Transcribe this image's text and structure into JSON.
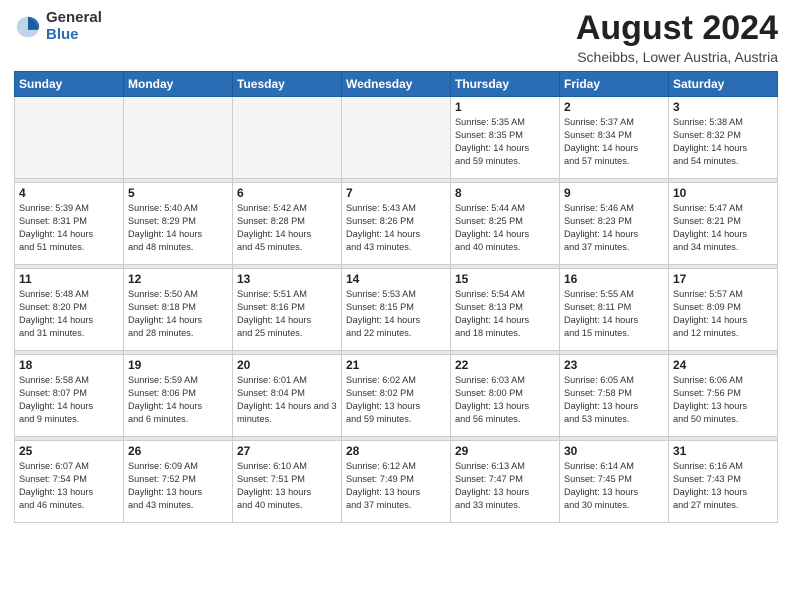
{
  "logo": {
    "general": "General",
    "blue": "Blue"
  },
  "title": "August 2024",
  "location": "Scheibbs, Lower Austria, Austria",
  "days_of_week": [
    "Sunday",
    "Monday",
    "Tuesday",
    "Wednesday",
    "Thursday",
    "Friday",
    "Saturday"
  ],
  "weeks": [
    [
      {
        "day": "",
        "info": ""
      },
      {
        "day": "",
        "info": ""
      },
      {
        "day": "",
        "info": ""
      },
      {
        "day": "",
        "info": ""
      },
      {
        "day": "1",
        "info": "Sunrise: 5:35 AM\nSunset: 8:35 PM\nDaylight: 14 hours\nand 59 minutes."
      },
      {
        "day": "2",
        "info": "Sunrise: 5:37 AM\nSunset: 8:34 PM\nDaylight: 14 hours\nand 57 minutes."
      },
      {
        "day": "3",
        "info": "Sunrise: 5:38 AM\nSunset: 8:32 PM\nDaylight: 14 hours\nand 54 minutes."
      }
    ],
    [
      {
        "day": "4",
        "info": "Sunrise: 5:39 AM\nSunset: 8:31 PM\nDaylight: 14 hours\nand 51 minutes."
      },
      {
        "day": "5",
        "info": "Sunrise: 5:40 AM\nSunset: 8:29 PM\nDaylight: 14 hours\nand 48 minutes."
      },
      {
        "day": "6",
        "info": "Sunrise: 5:42 AM\nSunset: 8:28 PM\nDaylight: 14 hours\nand 45 minutes."
      },
      {
        "day": "7",
        "info": "Sunrise: 5:43 AM\nSunset: 8:26 PM\nDaylight: 14 hours\nand 43 minutes."
      },
      {
        "day": "8",
        "info": "Sunrise: 5:44 AM\nSunset: 8:25 PM\nDaylight: 14 hours\nand 40 minutes."
      },
      {
        "day": "9",
        "info": "Sunrise: 5:46 AM\nSunset: 8:23 PM\nDaylight: 14 hours\nand 37 minutes."
      },
      {
        "day": "10",
        "info": "Sunrise: 5:47 AM\nSunset: 8:21 PM\nDaylight: 14 hours\nand 34 minutes."
      }
    ],
    [
      {
        "day": "11",
        "info": "Sunrise: 5:48 AM\nSunset: 8:20 PM\nDaylight: 14 hours\nand 31 minutes."
      },
      {
        "day": "12",
        "info": "Sunrise: 5:50 AM\nSunset: 8:18 PM\nDaylight: 14 hours\nand 28 minutes."
      },
      {
        "day": "13",
        "info": "Sunrise: 5:51 AM\nSunset: 8:16 PM\nDaylight: 14 hours\nand 25 minutes."
      },
      {
        "day": "14",
        "info": "Sunrise: 5:53 AM\nSunset: 8:15 PM\nDaylight: 14 hours\nand 22 minutes."
      },
      {
        "day": "15",
        "info": "Sunrise: 5:54 AM\nSunset: 8:13 PM\nDaylight: 14 hours\nand 18 minutes."
      },
      {
        "day": "16",
        "info": "Sunrise: 5:55 AM\nSunset: 8:11 PM\nDaylight: 14 hours\nand 15 minutes."
      },
      {
        "day": "17",
        "info": "Sunrise: 5:57 AM\nSunset: 8:09 PM\nDaylight: 14 hours\nand 12 minutes."
      }
    ],
    [
      {
        "day": "18",
        "info": "Sunrise: 5:58 AM\nSunset: 8:07 PM\nDaylight: 14 hours\nand 9 minutes."
      },
      {
        "day": "19",
        "info": "Sunrise: 5:59 AM\nSunset: 8:06 PM\nDaylight: 14 hours\nand 6 minutes."
      },
      {
        "day": "20",
        "info": "Sunrise: 6:01 AM\nSunset: 8:04 PM\nDaylight: 14 hours and 3 minutes."
      },
      {
        "day": "21",
        "info": "Sunrise: 6:02 AM\nSunset: 8:02 PM\nDaylight: 13 hours\nand 59 minutes."
      },
      {
        "day": "22",
        "info": "Sunrise: 6:03 AM\nSunset: 8:00 PM\nDaylight: 13 hours\nand 56 minutes."
      },
      {
        "day": "23",
        "info": "Sunrise: 6:05 AM\nSunset: 7:58 PM\nDaylight: 13 hours\nand 53 minutes."
      },
      {
        "day": "24",
        "info": "Sunrise: 6:06 AM\nSunset: 7:56 PM\nDaylight: 13 hours\nand 50 minutes."
      }
    ],
    [
      {
        "day": "25",
        "info": "Sunrise: 6:07 AM\nSunset: 7:54 PM\nDaylight: 13 hours\nand 46 minutes."
      },
      {
        "day": "26",
        "info": "Sunrise: 6:09 AM\nSunset: 7:52 PM\nDaylight: 13 hours\nand 43 minutes."
      },
      {
        "day": "27",
        "info": "Sunrise: 6:10 AM\nSunset: 7:51 PM\nDaylight: 13 hours\nand 40 minutes."
      },
      {
        "day": "28",
        "info": "Sunrise: 6:12 AM\nSunset: 7:49 PM\nDaylight: 13 hours\nand 37 minutes."
      },
      {
        "day": "29",
        "info": "Sunrise: 6:13 AM\nSunset: 7:47 PM\nDaylight: 13 hours\nand 33 minutes."
      },
      {
        "day": "30",
        "info": "Sunrise: 6:14 AM\nSunset: 7:45 PM\nDaylight: 13 hours\nand 30 minutes."
      },
      {
        "day": "31",
        "info": "Sunrise: 6:16 AM\nSunset: 7:43 PM\nDaylight: 13 hours\nand 27 minutes."
      }
    ]
  ]
}
